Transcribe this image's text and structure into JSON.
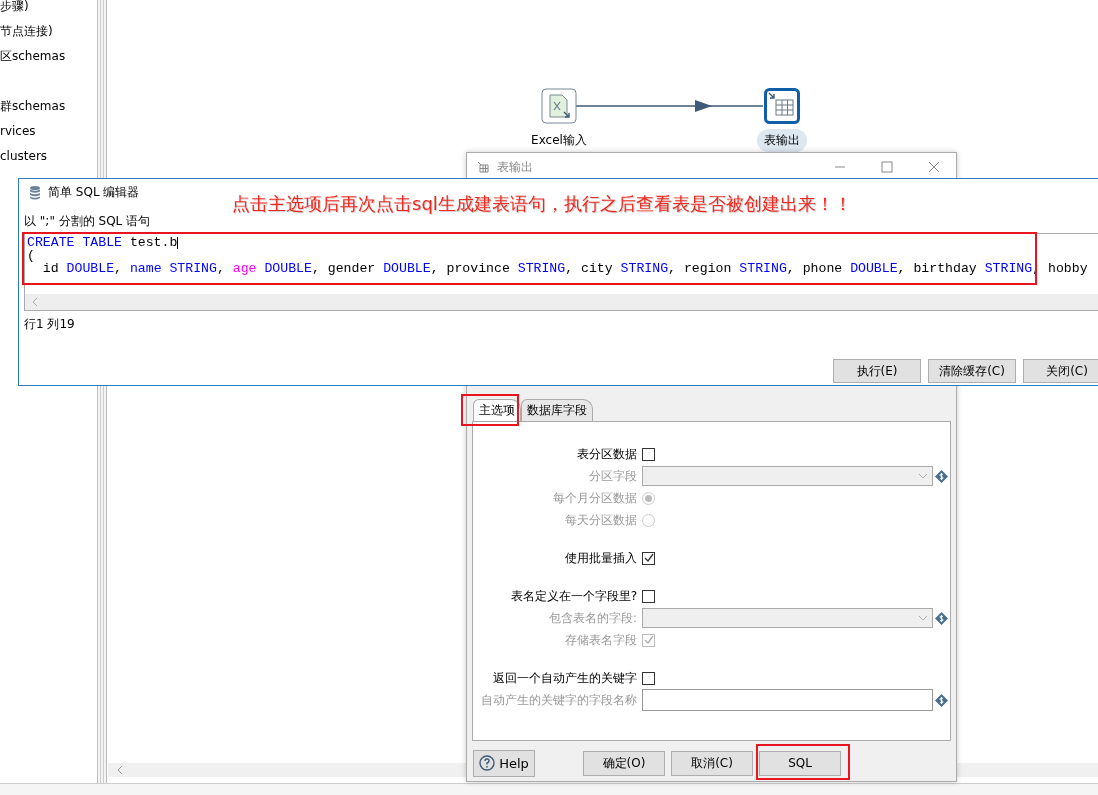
{
  "sidebar": {
    "items": [
      "步骤)",
      "节点连接)",
      "区schemas",
      "群schemas",
      "rvices",
      "clusters"
    ]
  },
  "canvas": {
    "nodes": [
      {
        "label": "Excel输入",
        "kind": "excel",
        "selected": false
      },
      {
        "label": "表输出",
        "kind": "table",
        "selected": true
      }
    ]
  },
  "table_output_dialog": {
    "title": "表输出",
    "tabs": [
      {
        "label": "主选项",
        "selected": true
      },
      {
        "label": "数据库字段",
        "selected": false
      }
    ],
    "sections": [
      [
        {
          "kind": "checkbox",
          "label": "表分区数据",
          "checked": false,
          "disabled": false
        },
        {
          "kind": "combo",
          "label": "分区字段",
          "disabled": true
        },
        {
          "kind": "radio",
          "label": "每个月分区数据",
          "selected": true,
          "disabled": true
        },
        {
          "kind": "radio",
          "label": "每天分区数据",
          "selected": false,
          "disabled": true
        }
      ],
      [
        {
          "kind": "checkbox",
          "label": "使用批量插入",
          "checked": true,
          "disabled": false
        }
      ],
      [
        {
          "kind": "checkbox",
          "label": "表名定义在一个字段里?",
          "checked": false,
          "disabled": false
        },
        {
          "kind": "combo",
          "label": "包含表名的字段:",
          "disabled": true
        },
        {
          "kind": "checkbox",
          "label": "存储表名字段",
          "checked": true,
          "disabled": true
        }
      ],
      [
        {
          "kind": "checkbox",
          "label": "返回一个自动产生的关键字",
          "checked": false,
          "disabled": false
        },
        {
          "kind": "text",
          "label": "自动产生的关键字的字段名称",
          "disabled": true
        }
      ]
    ],
    "buttons": [
      {
        "label": "Help",
        "kind": "help"
      },
      {
        "label": "确定(O)",
        "kind": "plain"
      },
      {
        "label": "取消(C)",
        "kind": "plain"
      },
      {
        "label": "SQL",
        "kind": "plain"
      }
    ]
  },
  "sql_editor": {
    "title": "简单 SQL 编辑器",
    "hint": "以 \";\" 分割的 SQL 语句",
    "lines": [
      [
        {
          "text": "CREATE TABLE",
          "kind": "keyword"
        },
        {
          "text": " test.b",
          "kind": "plain"
        }
      ],
      [
        {
          "text": "(",
          "kind": "plain"
        }
      ],
      [
        {
          "text": "  id ",
          "kind": "plain"
        },
        {
          "text": "DOUBLE",
          "kind": "keyword"
        },
        {
          "text": ", ",
          "kind": "plain"
        },
        {
          "text": "name STRING",
          "kind": "keyword"
        },
        {
          "text": ", ",
          "kind": "plain"
        },
        {
          "text": "age",
          "kind": "function"
        },
        {
          "text": " DOUBLE",
          "kind": "keyword"
        },
        {
          "text": ", gender ",
          "kind": "plain"
        },
        {
          "text": "DOUBLE",
          "kind": "keyword"
        },
        {
          "text": ", province ",
          "kind": "plain"
        },
        {
          "text": "STRING",
          "kind": "keyword"
        },
        {
          "text": ", city ",
          "kind": "plain"
        },
        {
          "text": "STRING",
          "kind": "keyword"
        },
        {
          "text": ", region ",
          "kind": "plain"
        },
        {
          "text": "STRING",
          "kind": "keyword"
        },
        {
          "text": ", phone ",
          "kind": "plain"
        },
        {
          "text": "DOUBLE",
          "kind": "keyword"
        },
        {
          "text": ", birthday ",
          "kind": "plain"
        },
        {
          "text": "STRING",
          "kind": "keyword"
        },
        {
          "text": ", hobby",
          "kind": "plain"
        }
      ]
    ],
    "cursor_position": "行1 列19",
    "buttons": [
      "执行(E)",
      "清除缓存(C)",
      "关闭(C)"
    ]
  },
  "annotation": {
    "text": "点击主选项后再次点击sql生成建表语句，执行之后查看表是否被创建出来！！"
  }
}
